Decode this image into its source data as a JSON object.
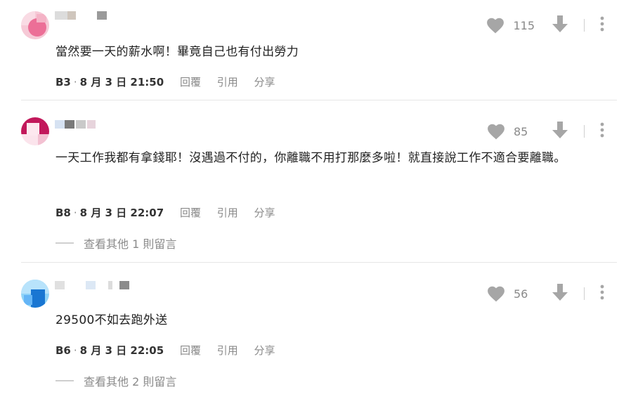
{
  "comments": [
    {
      "text": "當然要一天的薪水啊！畢竟自己也有付出勞力",
      "floor": "B3",
      "date": "8 月 3 日 21:50",
      "likes": "115",
      "reply_label": "回覆",
      "quote_label": "引用",
      "share_label": "分享",
      "avatar_colors": [
        "#f2a3b8",
        "#e85d86"
      ]
    },
    {
      "text": "一天工作我都有拿錢耶！沒遇過不付的，你離職不用打那麼多啦！就直接說工作不適合要離職。",
      "floor": "B8",
      "date": "8 月 3 日 22:07",
      "likes": "85",
      "reply_label": "回覆",
      "quote_label": "引用",
      "share_label": "分享",
      "more_replies": "查看其他 1 則留言",
      "avatar_colors": [
        "#c2185b",
        "#f8bbd0"
      ]
    },
    {
      "text": "29500不如去跑外送",
      "floor": "B6",
      "date": "8 月 3 日 22:05",
      "likes": "56",
      "reply_label": "回覆",
      "quote_label": "引用",
      "share_label": "分享",
      "more_replies": "查看其他 2 則留言",
      "avatar_colors": [
        "#4fc3f7",
        "#1e88e5"
      ]
    }
  ],
  "meta_separator": "·",
  "icons": {
    "like": "heart-icon",
    "dislike": "arrow-down-icon",
    "more": "more-vertical-icon"
  },
  "colors": {
    "icon_gray": "#a6a6a6",
    "text_main": "#222222",
    "text_muted": "#8a8a8a"
  }
}
